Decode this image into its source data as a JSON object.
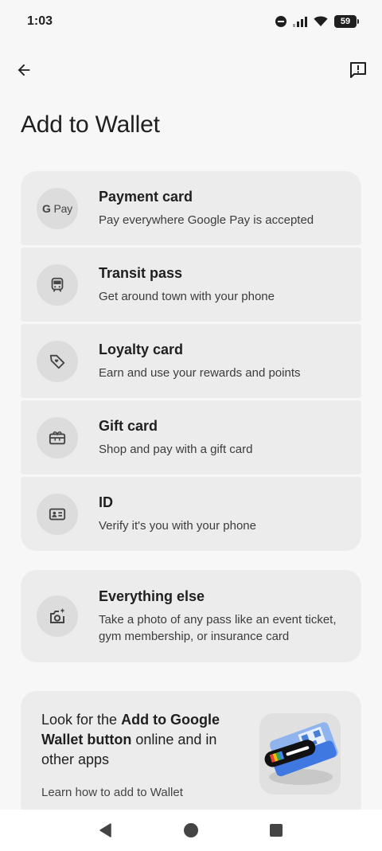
{
  "status_bar": {
    "time": "1:03",
    "battery": "59"
  },
  "header": {
    "title": "Add to Wallet"
  },
  "options": [
    {
      "icon": "gpay-icon",
      "icon_text_g": "G",
      "icon_text_pay": "Pay",
      "title": "Payment card",
      "description": "Pay everywhere Google Pay is accepted"
    },
    {
      "icon": "train-icon",
      "title": "Transit pass",
      "description": "Get around town with your phone"
    },
    {
      "icon": "heart-tag-icon",
      "title": "Loyalty card",
      "description": "Earn and use your rewards and points"
    },
    {
      "icon": "gift-card-icon",
      "title": "Gift card",
      "description": "Shop and pay with a gift card"
    },
    {
      "icon": "id-card-icon",
      "title": "ID",
      "description": "Verify it's you with your phone"
    }
  ],
  "everything_else": {
    "icon": "camera-sparkle-icon",
    "title": "Everything else",
    "description": "Take a photo of any pass like an event ticket, gym membership, or insurance card"
  },
  "promo": {
    "text_prefix": "Look for the ",
    "text_bold": "Add to Google Wallet button",
    "text_suffix": " online and in other apps",
    "link": "Learn how to add to Wallet"
  },
  "colors": {
    "background": "#f7f7f7",
    "card": "#ececec",
    "icon_circle": "#dcdcdc"
  }
}
